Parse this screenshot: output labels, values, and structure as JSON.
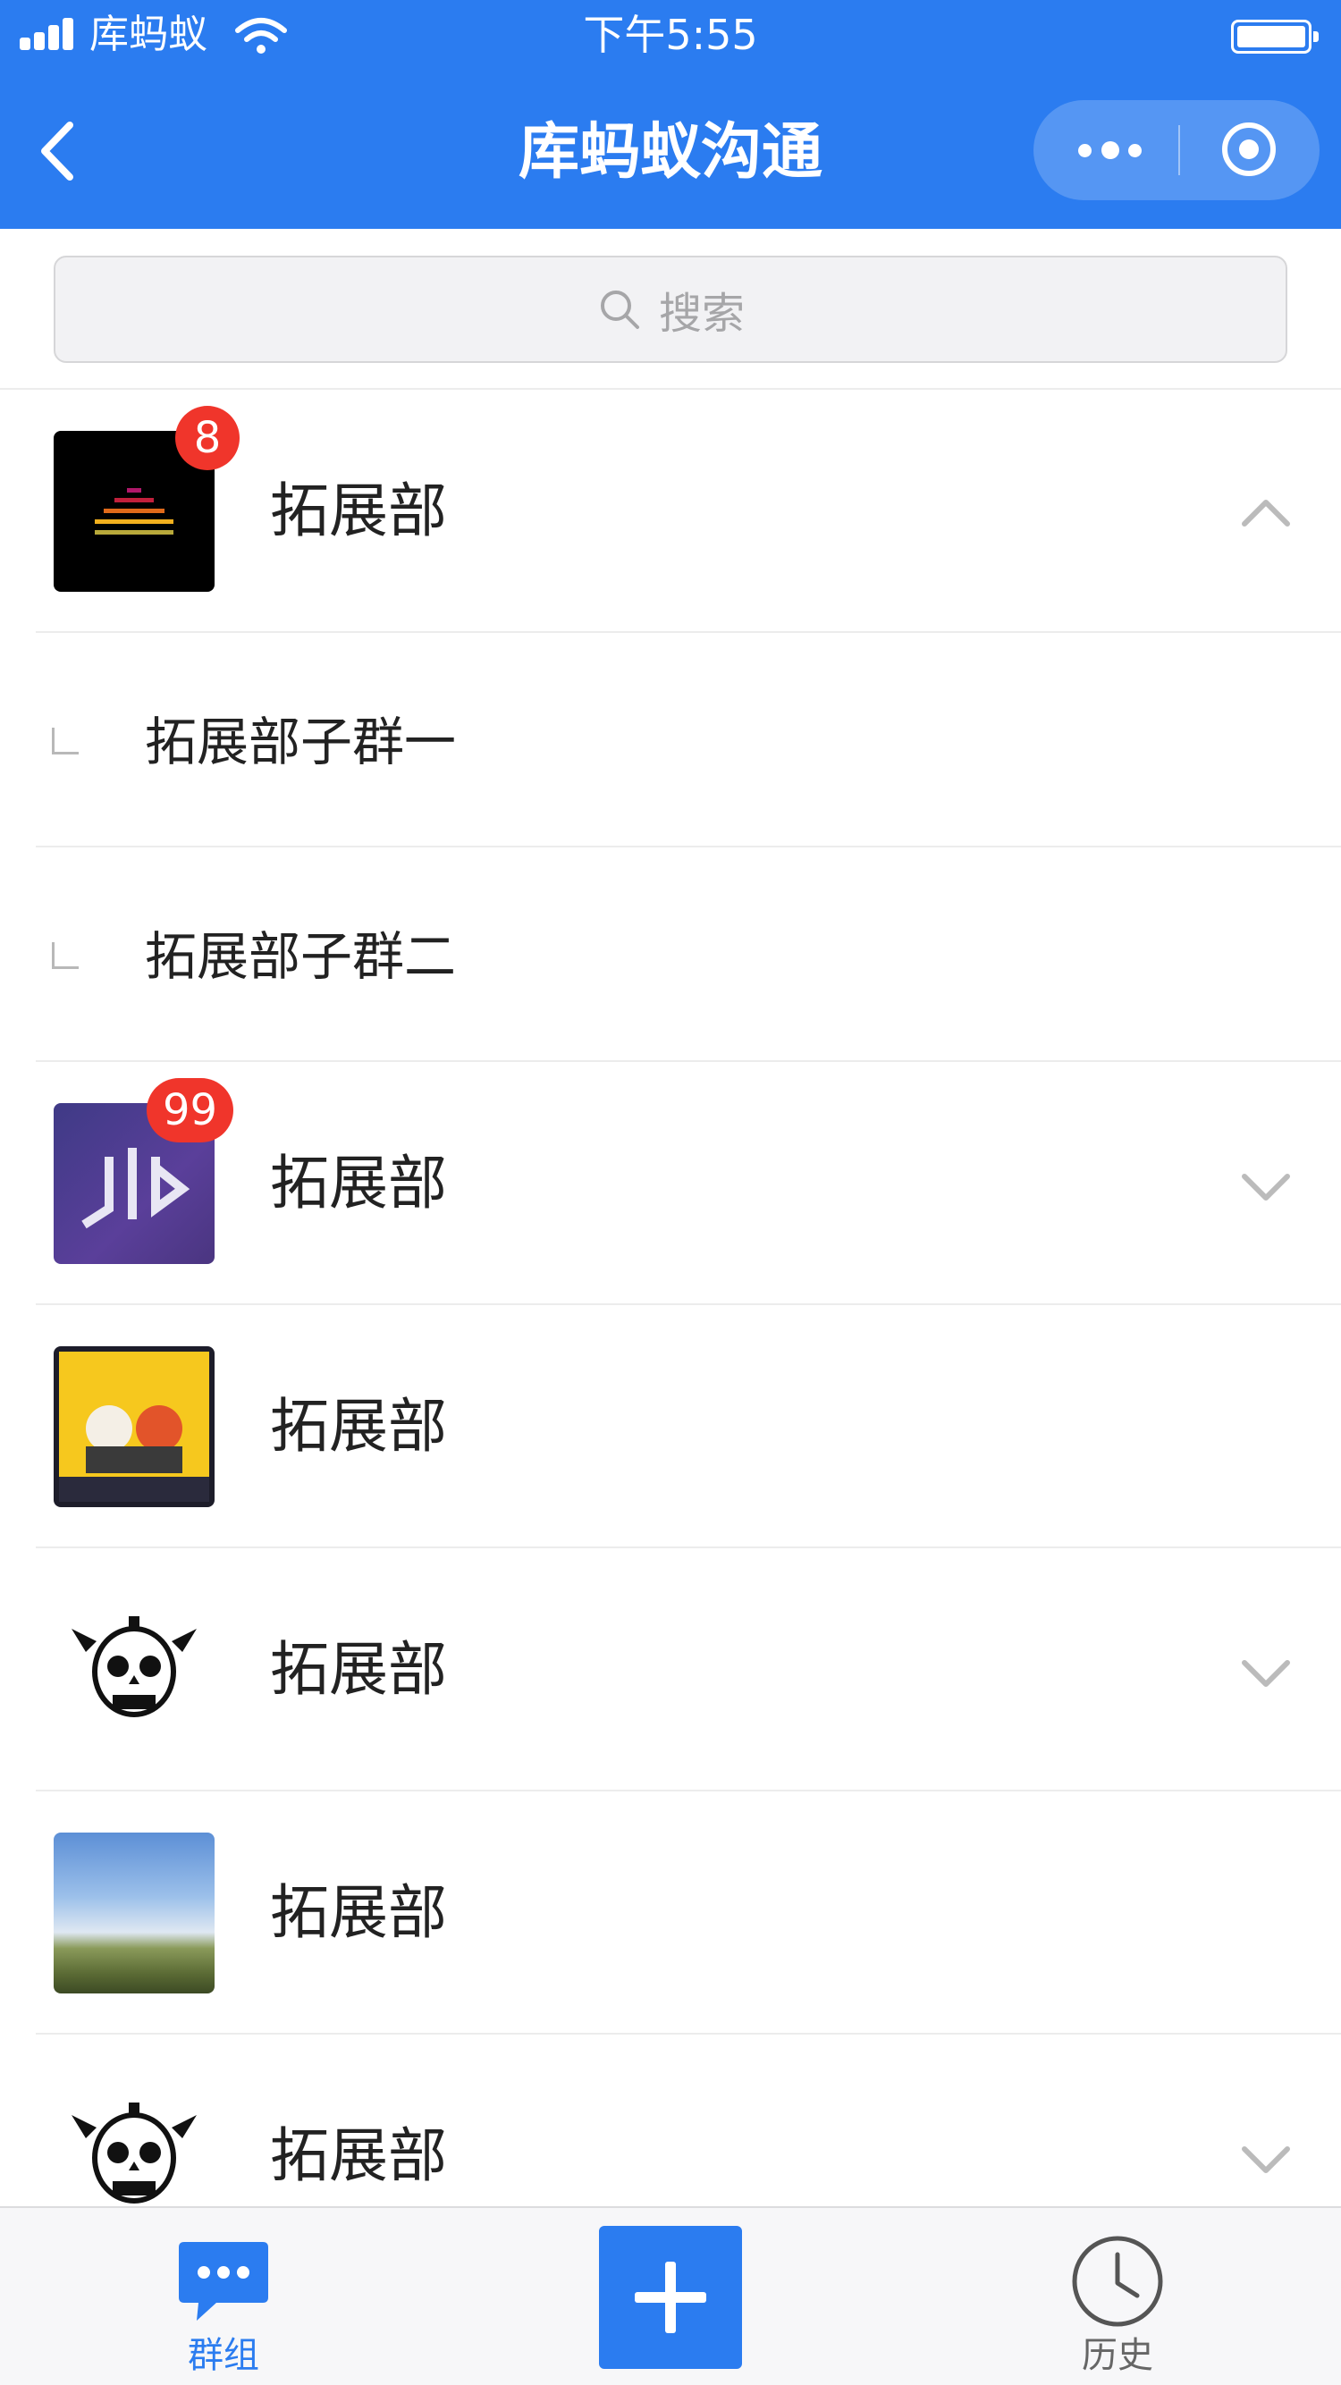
{
  "status_bar": {
    "carrier": "库蚂蚁",
    "time": "下午5:55"
  },
  "nav": {
    "title": "库蚂蚁沟通",
    "icons": [
      "back-arrow-icon",
      "more-dots-icon",
      "target-circle-icon"
    ]
  },
  "search": {
    "placeholder": "搜索"
  },
  "groups": [
    {
      "name": "拓展部",
      "badge": "8",
      "expanded": true,
      "avatar": "equalizer-logo",
      "subgroups": [
        {
          "name": "拓展部子群一"
        },
        {
          "name": "拓展部子群二"
        }
      ]
    },
    {
      "name": "拓展部",
      "badge": "99",
      "expanded": false,
      "avatar": "purple-logo"
    },
    {
      "name": "拓展部",
      "avatar": "cigareta-poster"
    },
    {
      "name": "拓展部",
      "expanded": false,
      "avatar": "skull-logo"
    },
    {
      "name": "拓展部",
      "avatar": "sky-landscape"
    },
    {
      "name": "拓展部",
      "expanded": false,
      "avatar": "skull-logo"
    }
  ],
  "tabbar": {
    "groups_label": "群组",
    "history_label": "历史",
    "add_icon": "plus-icon"
  },
  "colors": {
    "brand_blue": "#2b7cf0",
    "badge_red": "#f0352b",
    "divider": "#ececec"
  }
}
